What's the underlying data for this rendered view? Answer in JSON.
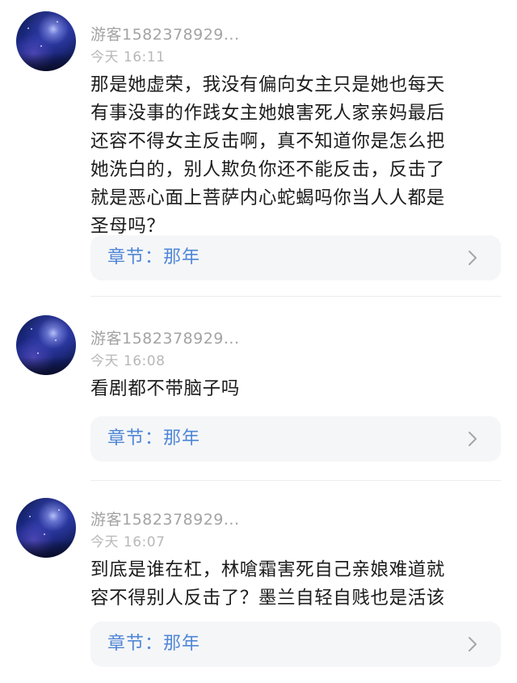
{
  "comments": [
    {
      "username": "游客1582378929...",
      "time": "今天 16:11",
      "text_lines": [
        "那是她虚荣，我没有偏向女主只是她也每天",
        "有事没事的作践女主她娘害死人家亲妈最后",
        "还容不得女主反击啊，真不知道你是怎么把",
        "她洗白的，别人欺负你还不能反击，反击了",
        "就是恶心面上菩萨内心蛇蝎吗你当人人都是",
        "圣母吗？"
      ],
      "chapter": "章节：那年",
      "avatar_icon": "avatar-galaxy-icon"
    },
    {
      "username": "游客1582378929...",
      "time": "今天 16:08",
      "text_lines": [
        "看剧都不带脑子吗"
      ],
      "chapter": "章节：那年",
      "avatar_icon": "avatar-galaxy-icon"
    },
    {
      "username": "游客1582378929...",
      "time": "今天 16:07",
      "text_lines": [
        "到底是谁在杠，林嗆霜害死自己亲娘难道就",
        "容不得别人反击了？墨兰自轻自贱也是活该"
      ],
      "chapter": "章节：那年",
      "avatar_icon": "avatar-galaxy-icon"
    }
  ],
  "icons": {
    "chapter_link": "chevron-right-icon"
  },
  "colors": {
    "chapter_text": "#4f87d6",
    "username": "#a3a3a3",
    "time": "#b8b8b8",
    "body_text": "#1c1c1c",
    "card_background": "#f5f6f8"
  }
}
